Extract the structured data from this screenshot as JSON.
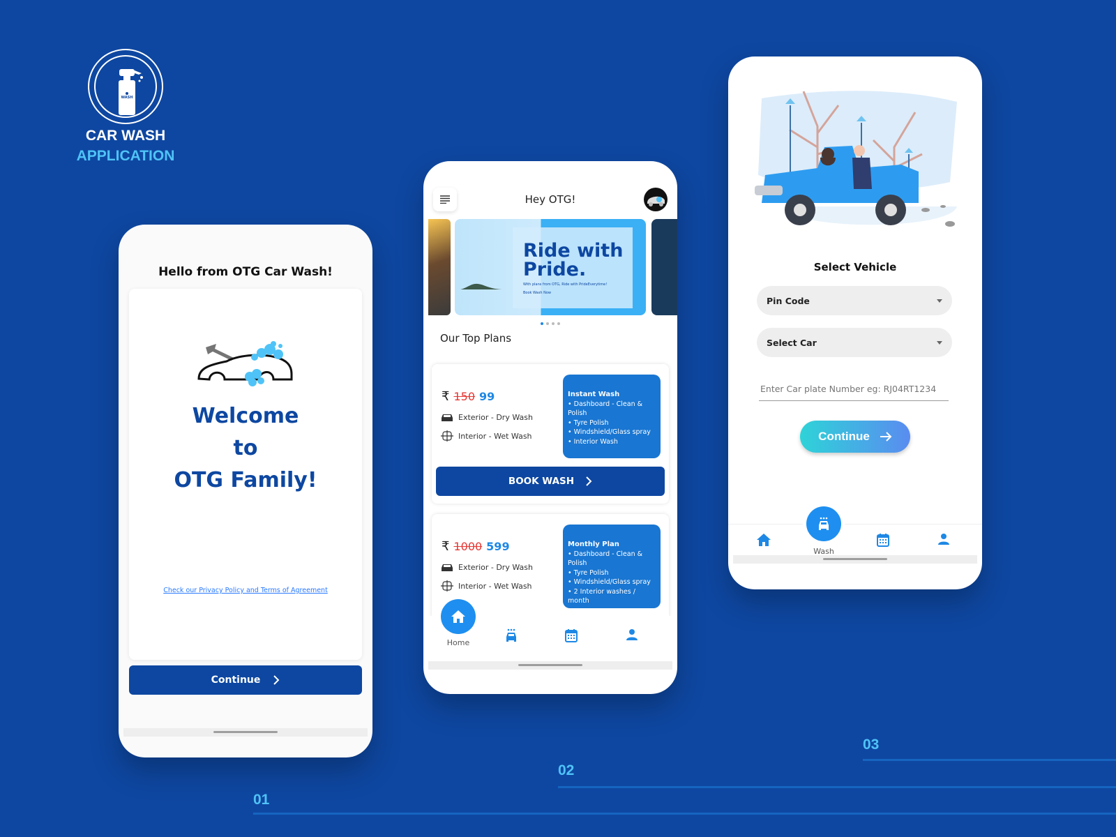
{
  "brand": {
    "title": "CAR WASH",
    "subtitle": "APPLICATION",
    "logo_icon": "spray-bottle-icon",
    "logo_label": "WASH"
  },
  "colors": {
    "background": "#0e47a1",
    "primary": "#0d47a1",
    "accent": "#1e88e5",
    "highlight": "#4fc3f7",
    "strike": "#e53935"
  },
  "steps": [
    "01",
    "02",
    "03"
  ],
  "screen1": {
    "greeting": "Hello from OTG Car Wash!",
    "welcome_lines": [
      "Welcome",
      "to",
      "OTG Family!"
    ],
    "privacy_link": "Check our Privacy Policy and Terms of Agreement",
    "continue_label": "Continue"
  },
  "screen2": {
    "title": "Hey OTG!",
    "banner": {
      "headline_1": "Ride with",
      "headline_2": "Pride.",
      "subtext": "With plans from OTG, Ride with PrideEverytime!",
      "cta": "Book Wash Now",
      "active_dot": 0,
      "dot_count": 4
    },
    "section_title": "Our Top Plans",
    "plans": [
      {
        "currency": "₹",
        "old_price": "150",
        "new_price": "99",
        "features": [
          "Exterior - Dry Wash",
          "Interior - Wet Wash"
        ],
        "name": "Instant Wash",
        "includes": [
          "• Dashboard - Clean & Polish",
          "• Tyre Polish",
          "• Windshield/Glass spray",
          "• Interior Wash"
        ],
        "button": "BOOK WASH"
      },
      {
        "currency": "₹",
        "old_price": "1000",
        "new_price": "599",
        "features": [
          "Exterior - Dry Wash",
          "Interior - Wet Wash"
        ],
        "name": "Monthly Plan",
        "includes": [
          "• Dashboard - Clean & Polish",
          "• Tyre Polish",
          "• Windshield/Glass spray",
          "• 2 Interior washes / month"
        ],
        "button": "BOOK WASH"
      }
    ],
    "nav": {
      "active": "Home",
      "active_label": "Home"
    }
  },
  "screen3": {
    "title": "Select Vehicle",
    "pin_code_label": "Pin Code",
    "select_car_label": "Select Car",
    "plate_placeholder": "Enter Car plate Number eg: RJ04RT1234",
    "continue_label": "Continue",
    "nav": {
      "active": "Wash",
      "active_label": "Wash"
    }
  }
}
